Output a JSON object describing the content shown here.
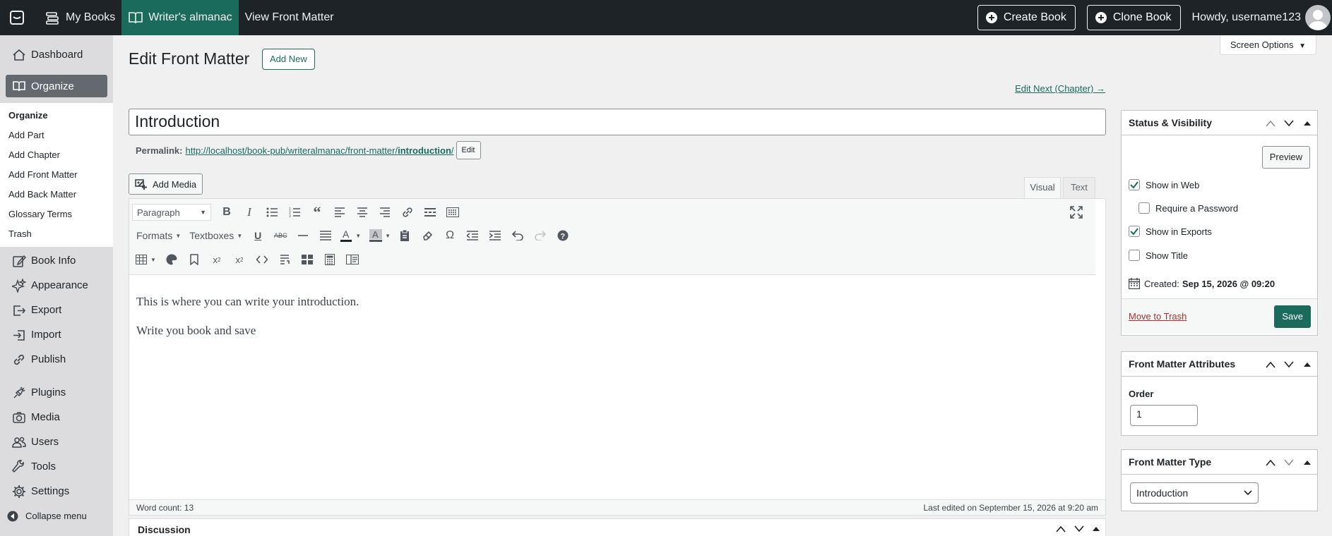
{
  "topbar": {
    "my_books": "My Books",
    "book_title": "Writer's almanac",
    "view_link": "View Front Matter",
    "create_book": "Create Book",
    "clone_book": "Clone Book",
    "howdy": "Howdy, username123"
  },
  "sidebar": {
    "dashboard": "Dashboard",
    "organize": "Organize",
    "sub": [
      "Organize",
      "Add Part",
      "Add Chapter",
      "Add Front Matter",
      "Add Back Matter",
      "Glossary Terms",
      "Trash"
    ],
    "book_info": "Book Info",
    "appearance": "Appearance",
    "export": "Export",
    "import": "Import",
    "publish": "Publish",
    "plugins": "Plugins",
    "media": "Media",
    "users": "Users",
    "tools": "Tools",
    "settings": "Settings",
    "collapse": "Collapse menu"
  },
  "screen_options": "Screen Options",
  "page": {
    "title": "Edit Front Matter",
    "add_new": "Add New",
    "edit_next": "Edit Next (Chapter) →",
    "post_title": "Introduction",
    "permalink_label": "Permalink:",
    "permalink_base": "http://localhost/book-pub/writeralmanac/front-matter/",
    "permalink_slug": "introduction",
    "permalink_tail": "/",
    "permalink_edit": "Edit",
    "add_media": "Add Media",
    "tab_visual": "Visual",
    "tab_text": "Text"
  },
  "editor": {
    "format_select": "Paragraph",
    "formats_menu": "Formats",
    "textboxes_menu": "Textboxes",
    "paragraphs": [
      "This is where you can write your introduction.",
      "Write you book and save"
    ],
    "word_count": "Word count: 13",
    "last_edited": "Last edited on September 15, 2026 at 9:20 am"
  },
  "discussion": {
    "title": "Discussion"
  },
  "status_box": {
    "title": "Status & Visibility",
    "preview": "Preview",
    "show_in_web": "Show in Web",
    "show_in_web_checked": true,
    "require_password": "Require a Password",
    "require_password_checked": false,
    "show_in_exports": "Show in Exports",
    "show_in_exports_checked": true,
    "show_title": "Show Title",
    "show_title_checked": false,
    "created_label": "Created:",
    "created_value": "Sep 15, 2026 @ 09:20",
    "move_to_trash": "Move to Trash",
    "save": "Save"
  },
  "attributes_box": {
    "title": "Front Matter Attributes",
    "order_label": "Order",
    "order_value": "1"
  },
  "type_box": {
    "title": "Front Matter Type",
    "selected": "Introduction"
  }
}
